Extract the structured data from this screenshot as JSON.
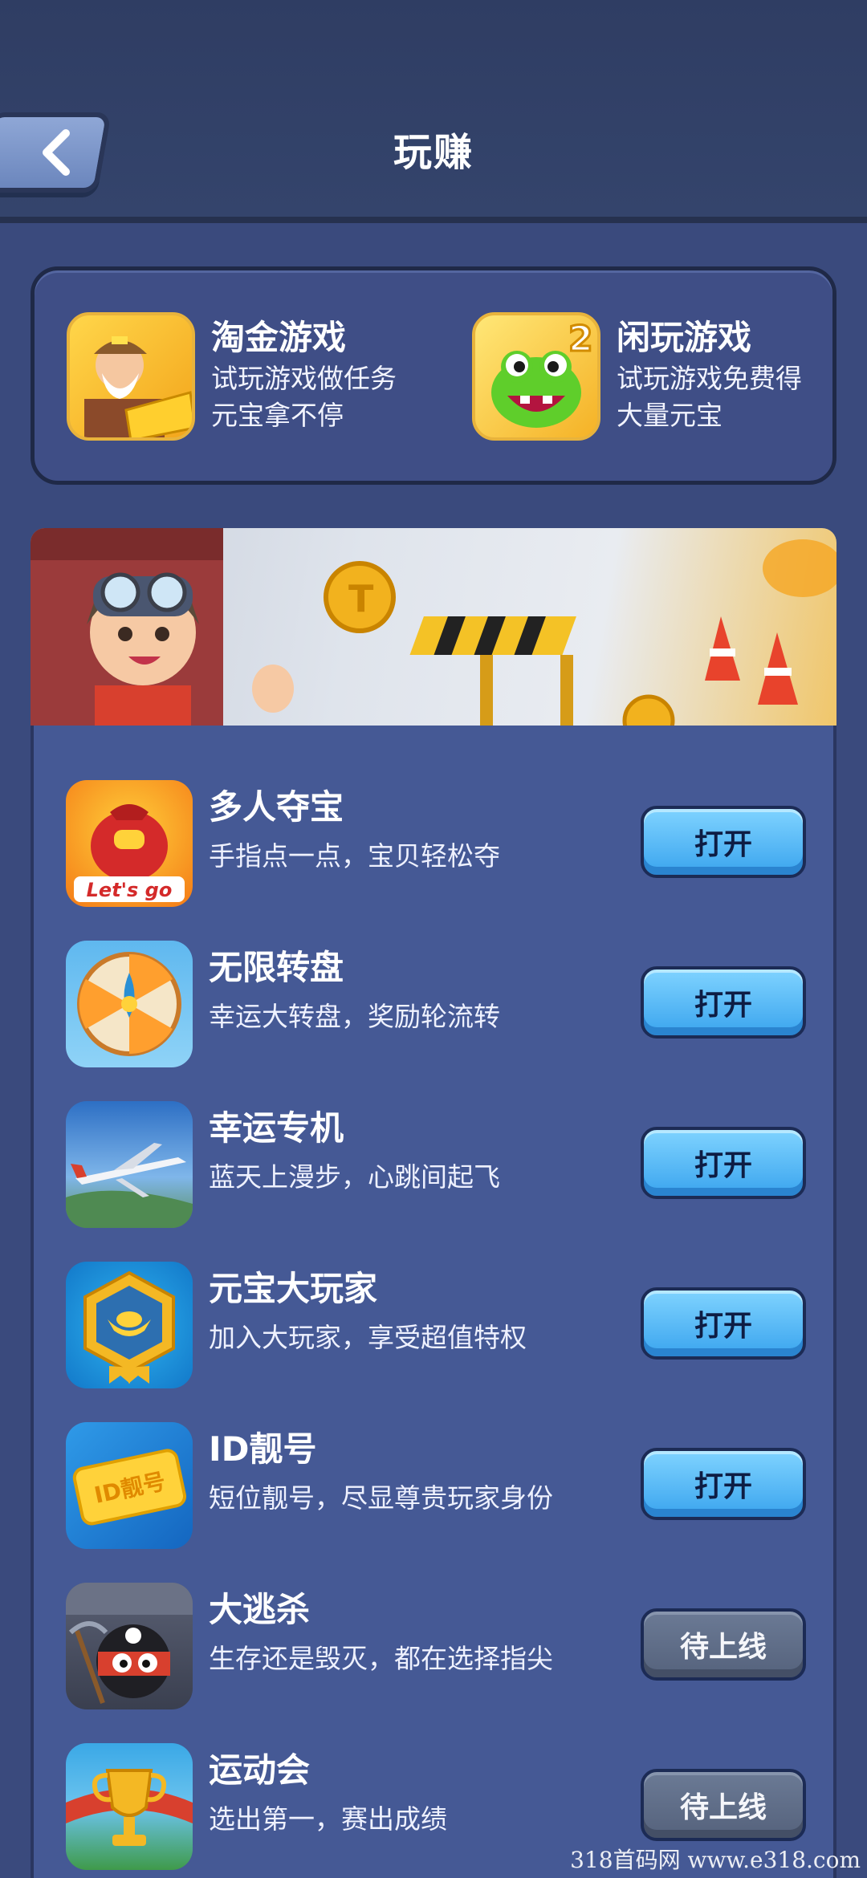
{
  "header": {
    "title": "玩赚"
  },
  "top_games": [
    {
      "title": "淘金游戏",
      "desc": "试玩游戏做任务元宝拿不停",
      "icon": "gold-miner-icon"
    },
    {
      "title": "闲玩游戏",
      "desc": "试玩游戏免费得大量元宝",
      "icon": "green-monster-icon"
    }
  ],
  "list": [
    {
      "name": "多人夺宝",
      "desc": "手指点一点，宝贝轻松夺",
      "button": "打开",
      "state": "open",
      "icon": "treasure-bag-icon",
      "icon_text": "Let's go"
    },
    {
      "name": "无限转盘",
      "desc": "幸运大转盘，奖励轮流转",
      "button": "打开",
      "state": "open",
      "icon": "wheel-icon"
    },
    {
      "name": "幸运专机",
      "desc": "蓝天上漫步，心跳间起飞",
      "button": "打开",
      "state": "open",
      "icon": "airplane-icon"
    },
    {
      "name": "元宝大玩家",
      "desc": "加入大玩家，享受超值特权",
      "button": "打开",
      "state": "open",
      "icon": "ingot-badge-icon"
    },
    {
      "name": "ID靓号",
      "desc": "短位靓号，尽显尊贵玩家身份",
      "button": "打开",
      "state": "open",
      "icon": "id-ticket-icon",
      "icon_text": "ID靓号"
    },
    {
      "name": "大逃杀",
      "desc": "生存还是毁灭，都在选择指尖",
      "button": "待上线",
      "state": "soon",
      "icon": "pirate-icon"
    },
    {
      "name": "运动会",
      "desc": "选出第一，赛出成绩",
      "button": "待上线",
      "state": "soon",
      "icon": "trophy-icon"
    }
  ],
  "watermark": "318首码网   www.e318.com",
  "colors": {
    "background": "#3a4a7d",
    "panel": "#455995",
    "open_button": "#4cb4f4",
    "soon_button": "#5f6c86"
  }
}
